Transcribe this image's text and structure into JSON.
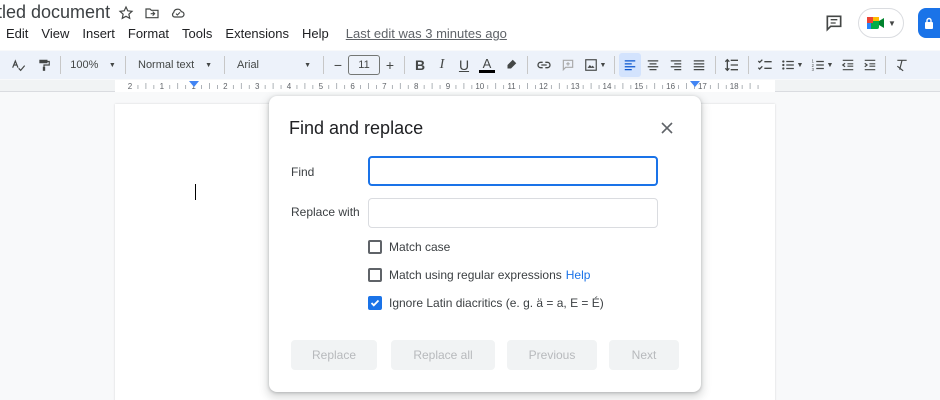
{
  "doc": {
    "title": "itled document"
  },
  "menu": {
    "items": [
      "Edit",
      "View",
      "Insert",
      "Format",
      "Tools",
      "Extensions",
      "Help"
    ],
    "last_edit": "Last edit was 3 minutes ago"
  },
  "toolbar": {
    "zoom": "100%",
    "style": "Normal text",
    "font": "Arial",
    "font_size": "11"
  },
  "ruler": {
    "ticks": [
      "2",
      "1",
      "1",
      "2",
      "3",
      "4",
      "5",
      "6",
      "7",
      "8",
      "9",
      "10",
      "11",
      "12",
      "13",
      "14",
      "15",
      "16",
      "17",
      "18"
    ]
  },
  "dialog": {
    "title": "Find and replace",
    "find_label": "Find",
    "find_value": "",
    "replace_label": "Replace with",
    "replace_value": "",
    "options": [
      {
        "label": "Match case",
        "checked": false
      },
      {
        "label": "Match using regular expressions",
        "checked": false,
        "help": "Help"
      },
      {
        "label": "Ignore Latin diacritics (e. g. ä = a, E = É)",
        "checked": true
      }
    ],
    "buttons": {
      "replace": "Replace",
      "replace_all": "Replace all",
      "previous": "Previous",
      "next": "Next"
    }
  },
  "colors": {
    "accent": "#1a73e8",
    "toolbar_bg": "#edf2fa",
    "disabled_text": "#b7b9bc"
  }
}
